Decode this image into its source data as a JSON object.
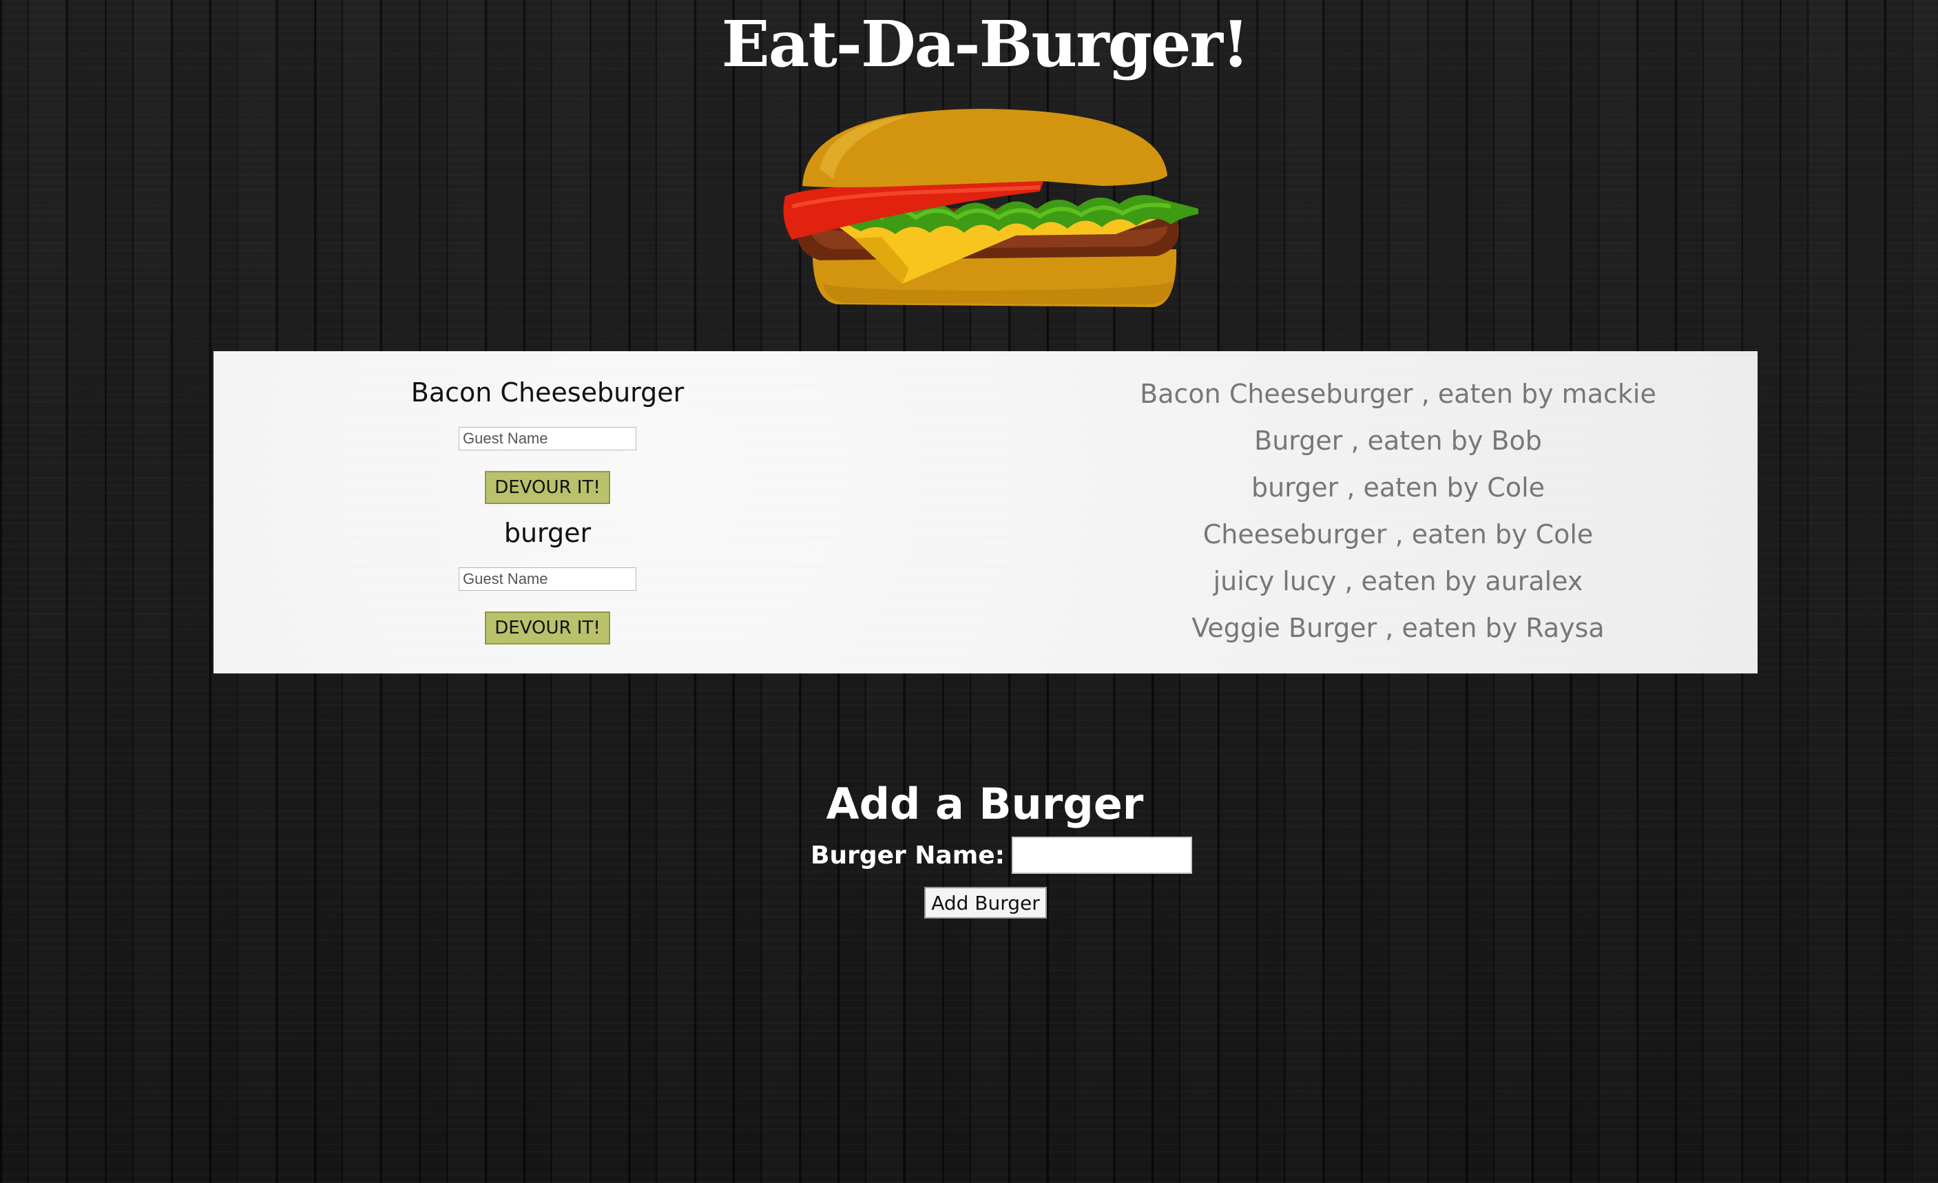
{
  "header": {
    "title": "Eat-Da-Burger!",
    "logo_icon": "burger-icon"
  },
  "menu": {
    "burgers": [
      {
        "name": "Bacon Cheeseburger",
        "guest_placeholder": "Guest Name",
        "devour_label": "DEVOUR IT!"
      },
      {
        "name": "burger",
        "guest_placeholder": "Guest Name",
        "devour_label": "DEVOUR IT!"
      }
    ]
  },
  "devoured": [
    "Bacon Cheeseburger , eaten by mackie",
    "Burger , eaten by Bob",
    "burger , eaten by Cole",
    "Cheeseburger , eaten by Cole",
    "juicy lucy , eaten by auralex",
    "Veggie Burger , eaten by Raysa"
  ],
  "add_form": {
    "title": "Add a Burger",
    "name_label": "Burger Name:",
    "name_value": "",
    "submit_label": "Add Burger"
  },
  "colors": {
    "devour_button": "#b9c16a",
    "panel_background": "#f1f1f1",
    "devoured_text": "#777777"
  }
}
